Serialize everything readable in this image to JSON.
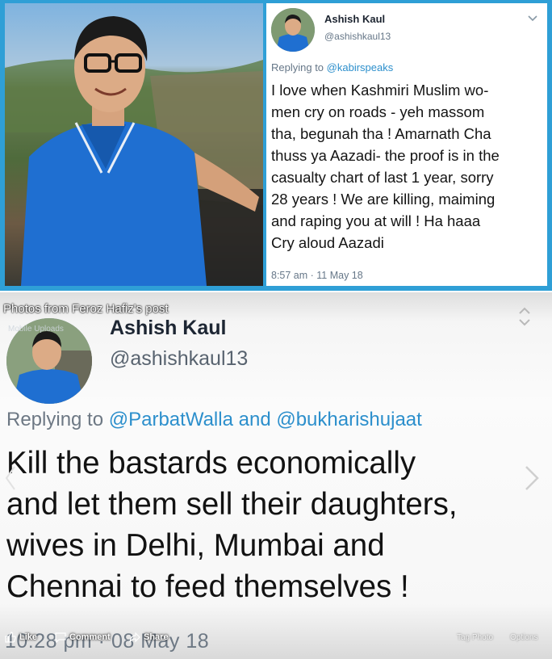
{
  "tweet_top": {
    "name": "Ashish Kaul",
    "handle": "@ashishkaul13",
    "replying_prefix": "Replying to",
    "replying_to": "@kabirspeaks",
    "body": "I love when Kashmiri Muslim wo-\nmen cry on roads - yeh massom\ntha, begunah tha !  Amarnath Cha\nthuss ya Aazadi- the proof is in the\ncasualty chart of last 1 year, sorry\n28 years ! We are killing, maiming\nand raping you at will ! Ha haaa\nCry aloud Aazadi",
    "timestamp": "8:57 am · 11 May 18",
    "colors": {
      "border": "#2f9fd6",
      "link": "#2c8fcc"
    }
  },
  "fb_viewer": {
    "caption": "Photos from Feroz Hafiz's post",
    "avatar_overlay": "Mobile Uploads",
    "name": "Ashish Kaul",
    "handle": "@ashishkaul13",
    "replying_prefix": "Replying to",
    "replying_to_1": "@ParbatWalla",
    "replying_and": "and",
    "replying_to_2": "@bukharishujaat",
    "body": "Kill the bastards economically\nand let them sell their daughters,\nwives in Delhi, Mumbai and\nChennai to feed themselves !",
    "timestamp": "10:28 pm · 08 May 18",
    "actions": {
      "like": "Like",
      "comment": "Comment",
      "share": "Share",
      "tag_photo": "Tag Photo",
      "options": "Options"
    }
  }
}
